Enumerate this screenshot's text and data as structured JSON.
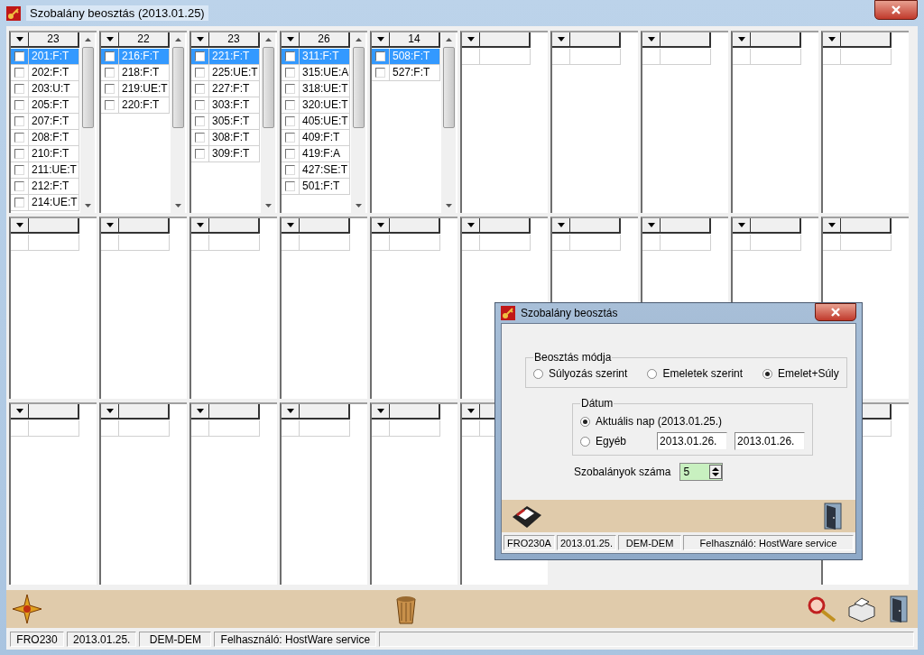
{
  "window": {
    "title": "Szobalány beosztás  (2013.01.25)"
  },
  "panels": [
    {
      "count": "23",
      "scrollbar": true,
      "rooms": [
        {
          "label": "201:F:T",
          "selected": true,
          "checked": false
        },
        {
          "label": "202:F:T",
          "selected": false,
          "checked": false
        },
        {
          "label": "203:U:T",
          "selected": false,
          "checked": false
        },
        {
          "label": "205:F:T",
          "selected": false,
          "checked": false
        },
        {
          "label": "207:F:T",
          "selected": false,
          "checked": false
        },
        {
          "label": "208:F:T",
          "selected": false,
          "checked": false
        },
        {
          "label": "210:F:T",
          "selected": false,
          "checked": false
        },
        {
          "label": "211:UE:T",
          "selected": false,
          "checked": false
        },
        {
          "label": "212:F:T",
          "selected": false,
          "checked": false
        },
        {
          "label": "214:UE:T",
          "selected": false,
          "checked": false
        }
      ]
    },
    {
      "count": "22",
      "scrollbar": true,
      "rooms": [
        {
          "label": "216:F:T",
          "selected": true,
          "checked": false
        },
        {
          "label": "218:F:T",
          "selected": false,
          "checked": false
        },
        {
          "label": "219:UE:T",
          "selected": false,
          "checked": false
        },
        {
          "label": "220:F:T",
          "selected": false,
          "checked": false
        }
      ]
    },
    {
      "count": "23",
      "scrollbar": true,
      "rooms": [
        {
          "label": "221:F:T",
          "selected": true,
          "checked": false
        },
        {
          "label": "225:UE:T",
          "selected": false,
          "checked": false
        },
        {
          "label": "227:F:T",
          "selected": false,
          "checked": false
        },
        {
          "label": "303:F:T",
          "selected": false,
          "checked": false
        },
        {
          "label": "305:F:T",
          "selected": false,
          "checked": false
        },
        {
          "label": "308:F:T",
          "selected": false,
          "checked": false
        },
        {
          "label": "309:F:T",
          "selected": false,
          "checked": false
        }
      ]
    },
    {
      "count": "26",
      "scrollbar": true,
      "rooms": [
        {
          "label": "311:F:T",
          "selected": true,
          "checked": false
        },
        {
          "label": "315:UE:A",
          "selected": false,
          "checked": false
        },
        {
          "label": "318:UE:T",
          "selected": false,
          "checked": false
        },
        {
          "label": "320:UE:T",
          "selected": false,
          "checked": false
        },
        {
          "label": "405:UE:T",
          "selected": false,
          "checked": false
        },
        {
          "label": "409:F:T",
          "selected": false,
          "checked": false
        },
        {
          "label": "419:F:A",
          "selected": false,
          "checked": false
        },
        {
          "label": "427:SE:T",
          "selected": false,
          "checked": false
        },
        {
          "label": "501:F:T",
          "selected": false,
          "checked": false
        }
      ]
    },
    {
      "count": "14",
      "scrollbar": true,
      "rooms": [
        {
          "label": "508:F:T",
          "selected": true,
          "checked": false
        },
        {
          "label": "527:F:T",
          "selected": false,
          "checked": false
        }
      ]
    },
    {
      "scrollbar": false
    },
    {
      "scrollbar": false
    },
    {
      "scrollbar": false
    },
    {
      "scrollbar": false
    },
    {
      "scrollbar": false
    },
    {
      "scrollbar": false
    },
    {
      "scrollbar": false
    },
    {
      "scrollbar": false
    },
    {
      "scrollbar": false
    },
    {
      "scrollbar": false
    },
    {
      "scrollbar": false
    },
    {
      "scrollbar": false
    },
    {
      "scrollbar": false
    },
    {
      "scrollbar": false
    },
    {
      "scrollbar": false
    },
    {
      "scrollbar": false
    },
    {
      "scrollbar": false
    },
    {
      "scrollbar": false
    },
    {
      "scrollbar": false
    },
    {
      "scrollbar": false
    },
    {
      "scrollbar": false
    },
    {
      "scrollbar": false
    }
  ],
  "status_bar": [
    "FRO230",
    "2013.01.25.",
    "DEM-DEM",
    "Felhasználó: HostWare service"
  ],
  "dialog": {
    "title": "Szobalány beosztás",
    "mode": {
      "legend": "Beosztás módja",
      "options": [
        {
          "label": "Súlyozás szerint",
          "selected": false
        },
        {
          "label": "Emeletek szerint",
          "selected": false
        },
        {
          "label": "Emelet+Súly",
          "selected": true
        }
      ]
    },
    "date": {
      "legend": "Dátum",
      "options": [
        {
          "label": "Aktuális nap (2013.01.25.)",
          "selected": true
        },
        {
          "label": "Egyéb",
          "selected": false,
          "from": "2013.01.26.",
          "to": "2013.01.26."
        }
      ]
    },
    "count_label": "Szobalányok száma",
    "count_value": "5",
    "status_bar": [
      "FRO230A",
      "2013.01.25.",
      "DEM-DEM",
      "Felhasználó: HostWare service"
    ]
  }
}
